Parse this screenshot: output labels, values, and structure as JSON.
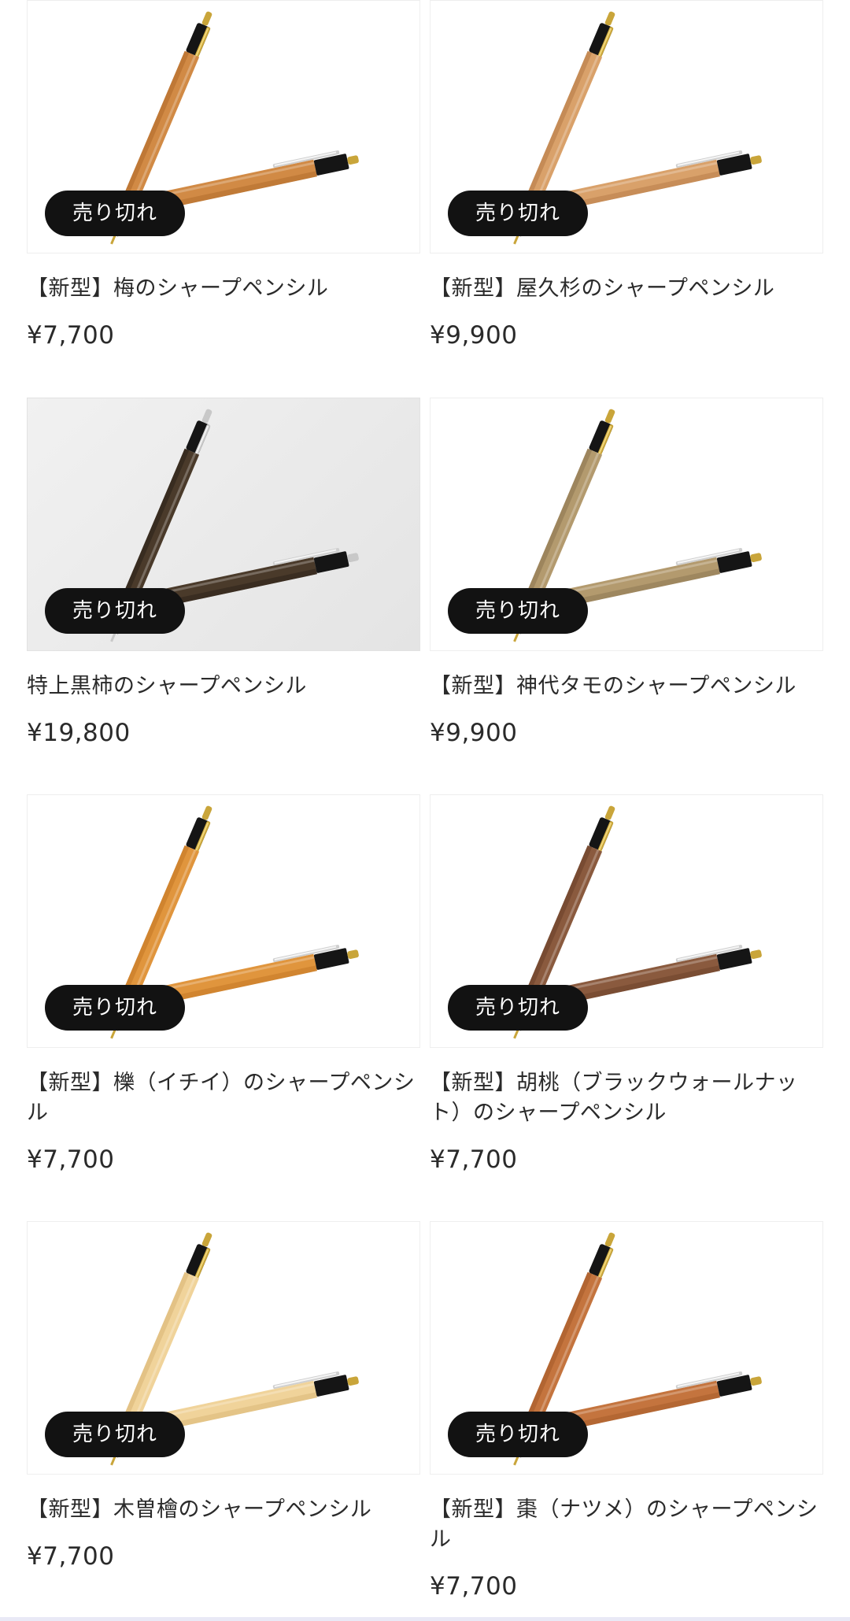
{
  "products": [
    {
      "name": "【新型】梅のシャープペンシル",
      "price": "¥7,700",
      "badge": "売り切れ",
      "wood_color": "#d18a45",
      "wood_dark": "#b06a2a",
      "clip": "gold"
    },
    {
      "name": "【新型】屋久杉のシャープペンシル",
      "price": "¥9,900",
      "badge": "売り切れ",
      "wood_color": "#d9a16a",
      "wood_dark": "#b57a45",
      "clip": "gold"
    },
    {
      "name": "特上黒柿のシャープペンシル",
      "price": "¥19,800",
      "badge": "売り切れ",
      "wood_color": "#4a3a2a",
      "wood_dark": "#2a2018",
      "clip": "silver"
    },
    {
      "name": "【新型】神代タモのシャープペンシル",
      "price": "¥9,900",
      "badge": "売り切れ",
      "wood_color": "#b39a6e",
      "wood_dark": "#8a7450",
      "clip": "gold"
    },
    {
      "name": "【新型】櫟（イチイ）のシャープペンシル",
      "price": "¥7,700",
      "badge": "売り切れ",
      "wood_color": "#e0953d",
      "wood_dark": "#c27624",
      "clip": "gold"
    },
    {
      "name": "【新型】胡桃（ブラックウォールナット）のシャープペンシル",
      "price": "¥7,700",
      "badge": "売り切れ",
      "wood_color": "#8a5a3e",
      "wood_dark": "#6a4028",
      "clip": "gold"
    },
    {
      "name": "【新型】木曽檜のシャープペンシル",
      "price": "¥7,700",
      "badge": "売り切れ",
      "wood_color": "#f0d39a",
      "wood_dark": "#d8b574",
      "clip": "gold"
    },
    {
      "name": "【新型】棗（ナツメ）のシャープペンシル",
      "price": "¥7,700",
      "badge": "売り切れ",
      "wood_color": "#c4743e",
      "wood_dark": "#a45a28",
      "clip": "gold"
    }
  ]
}
